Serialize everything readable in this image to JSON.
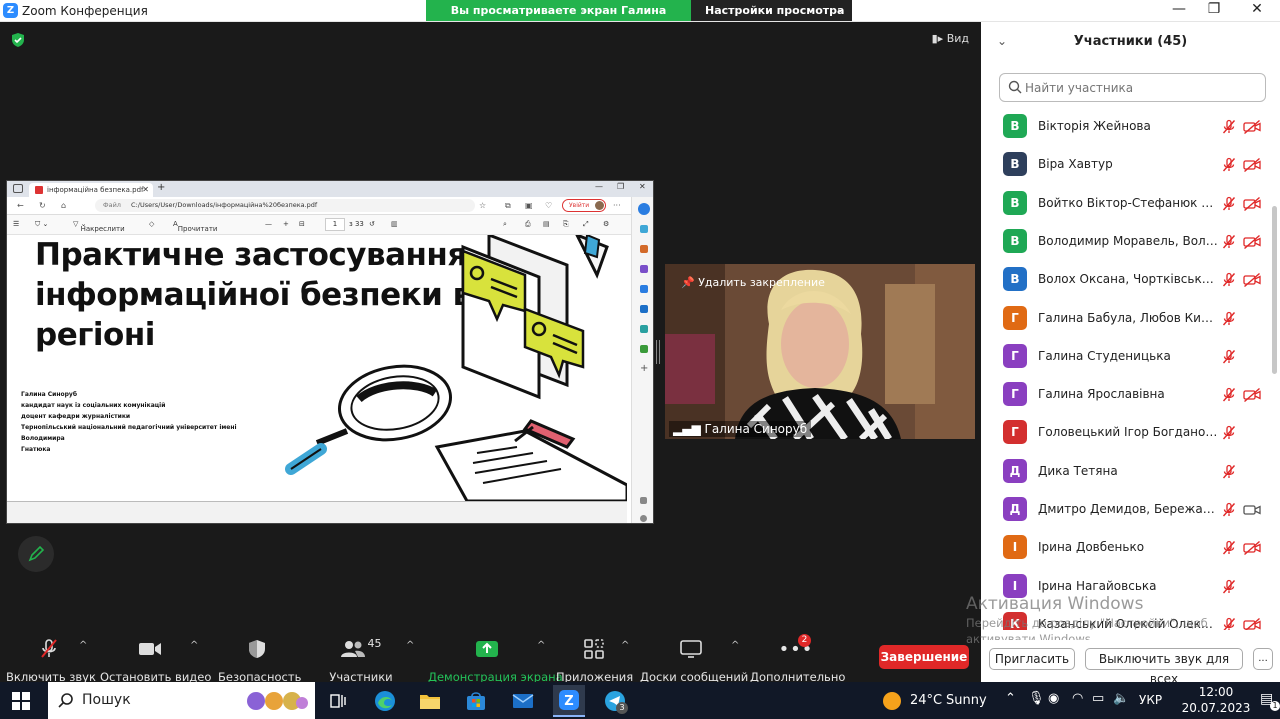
{
  "window": {
    "title": "Zoom Конференция"
  },
  "banner": {
    "viewing": "Вы просматриваете экран Галина Синоруб",
    "view_options": "Настройки просмотра"
  },
  "stage": {
    "view_label": "Вид"
  },
  "shared_browser": {
    "tab_title": "інформаційна безпека.pdf",
    "url_prefix": "Файл",
    "url": "C:/Users/User/Downloads/інформаційна%20безпека.pdf",
    "signin": "Увійти",
    "draw_label": "Накреслити",
    "read_aloud": "Прочитати вголос",
    "page_num": "1",
    "page_total": "з 33",
    "slide_title": "Практичне застосування інформаційної безпеки в регіоні",
    "author_lines": [
      "Галина Синоруб",
      "кандидат наук із соціальних комунікацій",
      "доцент кафедри журналістики",
      "Тернопільський національний педагогічний університет імені Володимира",
      "Гнатюка"
    ]
  },
  "video": {
    "unpin": "Удалить закрепление",
    "name": "Галина Синоруб"
  },
  "toolbar": {
    "unmute": "Включить звук",
    "stop_video": "Остановить видео",
    "security": "Безопасность",
    "participants": "Участники",
    "participants_count": "45",
    "share": "Демонстрация экрана",
    "apps": "Приложения",
    "whiteboards": "Доски сообщений",
    "more": "Дополнительно",
    "more_badge": "2",
    "end": "Завершение"
  },
  "panel": {
    "title": "Участники (45)",
    "search_placeholder": "Найти участника",
    "participants": [
      {
        "initial": "В",
        "name": "Вікторія Жейнова",
        "color": "#1fa855",
        "video": false
      },
      {
        "initial": "В",
        "name": "Віра Хавтур",
        "color": "#2e3f5c",
        "video": false
      },
      {
        "initial": "В",
        "name": "Войтко Віктор-Стефанюк Окса...",
        "color": "#1fa855",
        "video": false
      },
      {
        "initial": "В",
        "name": "Володимир Моравель, Волод...",
        "color": "#1fa855",
        "video": false
      },
      {
        "initial": "В",
        "name": "Волох Оксана, Чортківська РВА",
        "color": "#2270c6",
        "video": false
      },
      {
        "initial": "Г",
        "name": "Галина Бабула, Любов Кирилюк",
        "color": "#e06a14",
        "video": null
      },
      {
        "initial": "Г",
        "name": "Галина Студеницька",
        "color": "#8a3fc0",
        "video": null
      },
      {
        "initial": "Г",
        "name": "Галина Ярославівна",
        "color": "#8a3fc0",
        "video": false
      },
      {
        "initial": "Г",
        "name": "Головецький Ігор Богданович",
        "color": "#d32f2f",
        "video": null
      },
      {
        "initial": "Д",
        "name": "Дика Тетяна",
        "color": "#8a3fc0",
        "video": null
      },
      {
        "initial": "Д",
        "name": "Дмитро Демидов, Бережанськ...",
        "color": "#8a3fc0",
        "video": true
      },
      {
        "initial": "І",
        "name": "Ірина Довбенько",
        "color": "#e06a14",
        "video": false
      },
      {
        "initial": "І",
        "name": "Ірина Нагайовська",
        "color": "#8a3fc0",
        "video": null
      },
      {
        "initial": "К",
        "name": "Казанський Олексій Олександ...",
        "color": "#d32f2f",
        "video": false
      }
    ],
    "invite": "Пригласить",
    "mute_all": "Выключить звук для всех",
    "more": "..."
  },
  "watermark": {
    "title": "Активация Windows",
    "line1": "Перейдіть до розділу \"Настройки\", щоб",
    "line2": "активувати Windows."
  },
  "taskbar": {
    "search": "Пошук",
    "telegram_badge": "3",
    "weather_temp": "24°C",
    "weather_desc": "Sunny",
    "lang": "УКР",
    "time": "12:00",
    "date": "20.07.2023",
    "notif_count": "1"
  }
}
